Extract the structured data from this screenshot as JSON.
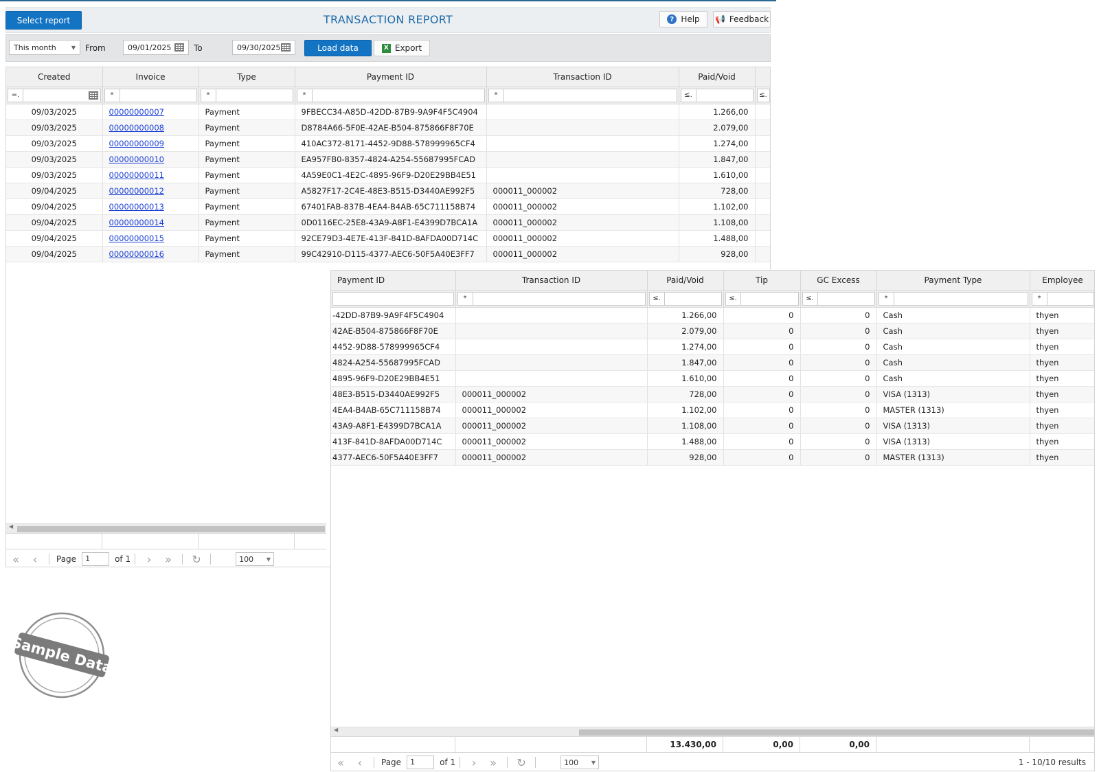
{
  "header": {
    "select_report_label": "Select report",
    "title": "TRANSACTION REPORT",
    "help_label": "Help",
    "feedback_label": "Feedback"
  },
  "toolbar": {
    "period_value": "This month",
    "from_label": "From",
    "from_date": "09/01/2025",
    "to_label": "To",
    "to_date": "09/30/2025",
    "load_label": "Load data",
    "export_label": "Export"
  },
  "grid_left": {
    "columns": [
      "Created",
      "Invoice",
      "Type",
      "Payment ID",
      "Transaction ID",
      "Paid/Void"
    ],
    "filters": [
      "=.",
      "*",
      "*",
      "*",
      "*",
      "≤.",
      "≤."
    ],
    "rows": [
      {
        "created": "09/03/2025",
        "invoice": "00000000007",
        "type": "Payment",
        "payment_id": "9FBECC34-A85D-42DD-87B9-9A9F4F5C4904",
        "transaction_id": "",
        "paid": "1.266,00"
      },
      {
        "created": "09/03/2025",
        "invoice": "00000000008",
        "type": "Payment",
        "payment_id": "D8784A66-5F0E-42AE-B504-875866F8F70E",
        "transaction_id": "",
        "paid": "2.079,00"
      },
      {
        "created": "09/03/2025",
        "invoice": "00000000009",
        "type": "Payment",
        "payment_id": "410AC372-8171-4452-9D88-578999965CF4",
        "transaction_id": "",
        "paid": "1.274,00"
      },
      {
        "created": "09/03/2025",
        "invoice": "00000000010",
        "type": "Payment",
        "payment_id": "EA957FB0-8357-4824-A254-55687995FCAD",
        "transaction_id": "",
        "paid": "1.847,00"
      },
      {
        "created": "09/03/2025",
        "invoice": "00000000011",
        "type": "Payment",
        "payment_id": "4A59E0C1-4E2C-4895-96F9-D20E29BB4E51",
        "transaction_id": "",
        "paid": "1.610,00"
      },
      {
        "created": "09/04/2025",
        "invoice": "00000000012",
        "type": "Payment",
        "payment_id": "A5827F17-2C4E-48E3-B515-D3440AE992F5",
        "transaction_id": "000011_000002",
        "paid": "728,00"
      },
      {
        "created": "09/04/2025",
        "invoice": "00000000013",
        "type": "Payment",
        "payment_id": "67401FAB-837B-4EA4-B4AB-65C711158B74",
        "transaction_id": "000011_000002",
        "paid": "1.102,00"
      },
      {
        "created": "09/04/2025",
        "invoice": "00000000014",
        "type": "Payment",
        "payment_id": "0D0116EC-25E8-43A9-A8F1-E4399D7BCA1A",
        "transaction_id": "000011_000002",
        "paid": "1.108,00"
      },
      {
        "created": "09/04/2025",
        "invoice": "00000000015",
        "type": "Payment",
        "payment_id": "92CE79D3-4E7E-413F-841D-8AFDA00D714C",
        "transaction_id": "000011_000002",
        "paid": "1.488,00"
      },
      {
        "created": "09/04/2025",
        "invoice": "00000000016",
        "type": "Payment",
        "payment_id": "99C42910-D115-4377-AEC6-50F5A40E3FF7",
        "transaction_id": "000011_000002",
        "paid": "928,00"
      }
    ],
    "pager": {
      "page_label": "Page",
      "page_value": "1",
      "of_label": "of 1",
      "page_size": "100"
    }
  },
  "grid_right": {
    "columns": [
      "Payment ID",
      "Transaction ID",
      "Paid/Void",
      "Tip",
      "GC Excess",
      "Payment Type",
      "Employee"
    ],
    "filters": [
      "",
      "*",
      "≤.",
      "≤.",
      "≤.",
      "*",
      "*"
    ],
    "rows": [
      {
        "payment_id": "-42DD-87B9-9A9F4F5C4904",
        "transaction_id": "",
        "paid": "1.266,00",
        "tip": "0",
        "gc": "0",
        "ptype": "Cash",
        "employee": "thyen"
      },
      {
        "payment_id": "42AE-B504-875866F8F70E",
        "transaction_id": "",
        "paid": "2.079,00",
        "tip": "0",
        "gc": "0",
        "ptype": "Cash",
        "employee": "thyen"
      },
      {
        "payment_id": "4452-9D88-578999965CF4",
        "transaction_id": "",
        "paid": "1.274,00",
        "tip": "0",
        "gc": "0",
        "ptype": "Cash",
        "employee": "thyen"
      },
      {
        "payment_id": "4824-A254-55687995FCAD",
        "transaction_id": "",
        "paid": "1.847,00",
        "tip": "0",
        "gc": "0",
        "ptype": "Cash",
        "employee": "thyen"
      },
      {
        "payment_id": "4895-96F9-D20E29BB4E51",
        "transaction_id": "",
        "paid": "1.610,00",
        "tip": "0",
        "gc": "0",
        "ptype": "Cash",
        "employee": "thyen"
      },
      {
        "payment_id": "48E3-B515-D3440AE992F5",
        "transaction_id": "000011_000002",
        "paid": "728,00",
        "tip": "0",
        "gc": "0",
        "ptype": "VISA (1313)",
        "employee": "thyen"
      },
      {
        "payment_id": "4EA4-B4AB-65C711158B74",
        "transaction_id": "000011_000002",
        "paid": "1.102,00",
        "tip": "0",
        "gc": "0",
        "ptype": "MASTER (1313)",
        "employee": "thyen"
      },
      {
        "payment_id": "43A9-A8F1-E4399D7BCA1A",
        "transaction_id": "000011_000002",
        "paid": "1.108,00",
        "tip": "0",
        "gc": "0",
        "ptype": "VISA (1313)",
        "employee": "thyen"
      },
      {
        "payment_id": "413F-841D-8AFDA00D714C",
        "transaction_id": "000011_000002",
        "paid": "1.488,00",
        "tip": "0",
        "gc": "0",
        "ptype": "VISA (1313)",
        "employee": "thyen"
      },
      {
        "payment_id": "4377-AEC6-50F5A40E3FF7",
        "transaction_id": "000011_000002",
        "paid": "928,00",
        "tip": "0",
        "gc": "0",
        "ptype": "MASTER (1313)",
        "employee": "thyen"
      }
    ],
    "totals": {
      "paid": "13.430,00",
      "tip": "0,00",
      "gc": "0,00"
    },
    "pager": {
      "page_label": "Page",
      "page_value": "1",
      "of_label": "of 1",
      "page_size": "100",
      "results": "1 - 10/10 results"
    }
  },
  "stamp": {
    "text": "Sample Data"
  },
  "colors": {
    "primary": "#1474c4",
    "title": "#1d6aa8",
    "link": "#1a3ed6"
  }
}
